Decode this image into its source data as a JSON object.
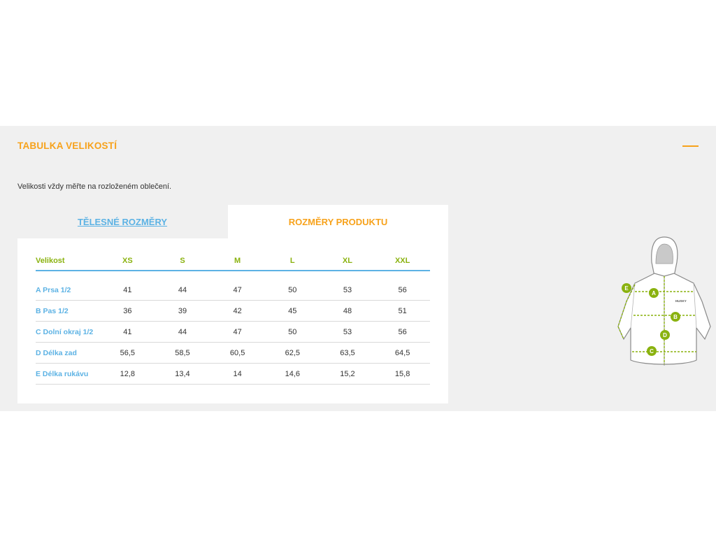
{
  "section": {
    "title": "TABULKA VELIKOSTÍ",
    "note": "Velikosti vždy měřte na rozloženém oblečení."
  },
  "tabs": [
    {
      "label": "TĚLESNÉ ROZMĚRY",
      "active": false
    },
    {
      "label": "ROZMĚRY PRODUKTU",
      "active": true
    }
  ],
  "table": {
    "header": [
      "Velikost",
      "XS",
      "S",
      "M",
      "L",
      "XL",
      "XXL"
    ],
    "rows": [
      {
        "label": "A Prsa 1/2",
        "values": [
          "41",
          "44",
          "47",
          "50",
          "53",
          "56"
        ]
      },
      {
        "label": "B Pas 1/2",
        "values": [
          "36",
          "39",
          "42",
          "45",
          "48",
          "51"
        ]
      },
      {
        "label": "C Dolní okraj 1/2",
        "values": [
          "41",
          "44",
          "47",
          "50",
          "53",
          "56"
        ]
      },
      {
        "label": "D Délka zad",
        "values": [
          "56,5",
          "58,5",
          "60,5",
          "62,5",
          "63,5",
          "64,5"
        ]
      },
      {
        "label": "E Délka rukávu",
        "values": [
          "12,8",
          "13,4",
          "14",
          "14,6",
          "15,2",
          "15,8"
        ]
      }
    ]
  },
  "diagram": {
    "markers": [
      "A",
      "B",
      "C",
      "D",
      "E"
    ],
    "brand_text": "HUSKY"
  },
  "colors": {
    "accent": "#f7a21b",
    "link": "#5cb2e4",
    "header_green": "#8ab20f",
    "marker_green": "#8ab20f",
    "panel_bg": "#f0f0f0"
  },
  "icons": {
    "collapse": "minus-icon"
  }
}
